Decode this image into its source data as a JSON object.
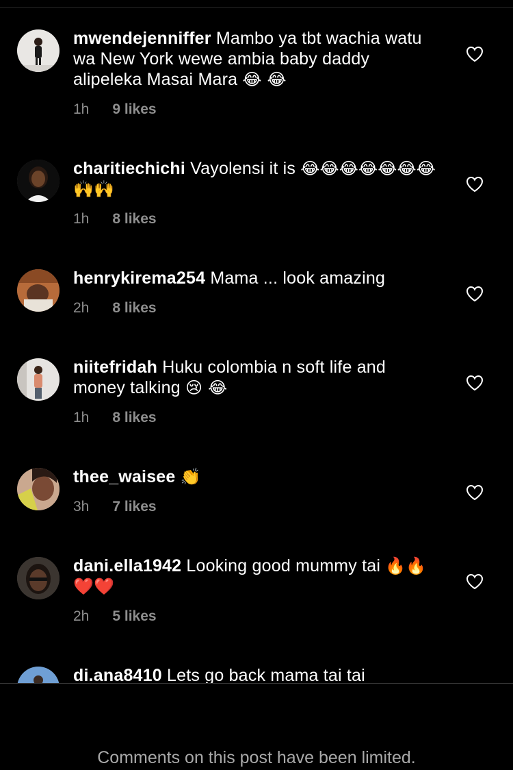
{
  "comments": [
    {
      "username": "mwendejenniffer",
      "text": "Mambo ya tbt wachia watu wa New York wewe ambia baby daddy alipeleka Masai Mara",
      "emojis": "😂 😂",
      "time": "1h",
      "likes": "9 likes"
    },
    {
      "username": "charitiechichi",
      "text": "Vayolensi it is",
      "emojis": "😂😂😂😂😂😂😂🙌🙌",
      "time": "1h",
      "likes": "8 likes"
    },
    {
      "username": "henrykirema254",
      "text": "Mama ... look amazing",
      "emojis": "",
      "time": "2h",
      "likes": "8 likes"
    },
    {
      "username": "niitefridah",
      "text": "Huku colombia n soft life and money talking",
      "emojis": "😢 😂",
      "time": "1h",
      "likes": "8 likes"
    },
    {
      "username": "thee_waisee",
      "text": "",
      "emojis": "👏",
      "time": "3h",
      "likes": "7 likes"
    },
    {
      "username": "dani.ella1942",
      "text": "Looking good mummy tai",
      "emojis": "🔥🔥❤️❤️",
      "time": "2h",
      "likes": "5 likes"
    },
    {
      "username": "di.ana8410",
      "text": "Lets go back mama tai tai",
      "emojis": "",
      "time": "",
      "likes": ""
    }
  ],
  "footer": {
    "limited_notice": "Comments on this post have been limited."
  },
  "icons": {
    "like": "heart-outline-icon"
  },
  "colors": {
    "background": "#000000",
    "text": "#ffffff",
    "meta": "#8e8e8e",
    "footer": "#a8a8a8"
  }
}
